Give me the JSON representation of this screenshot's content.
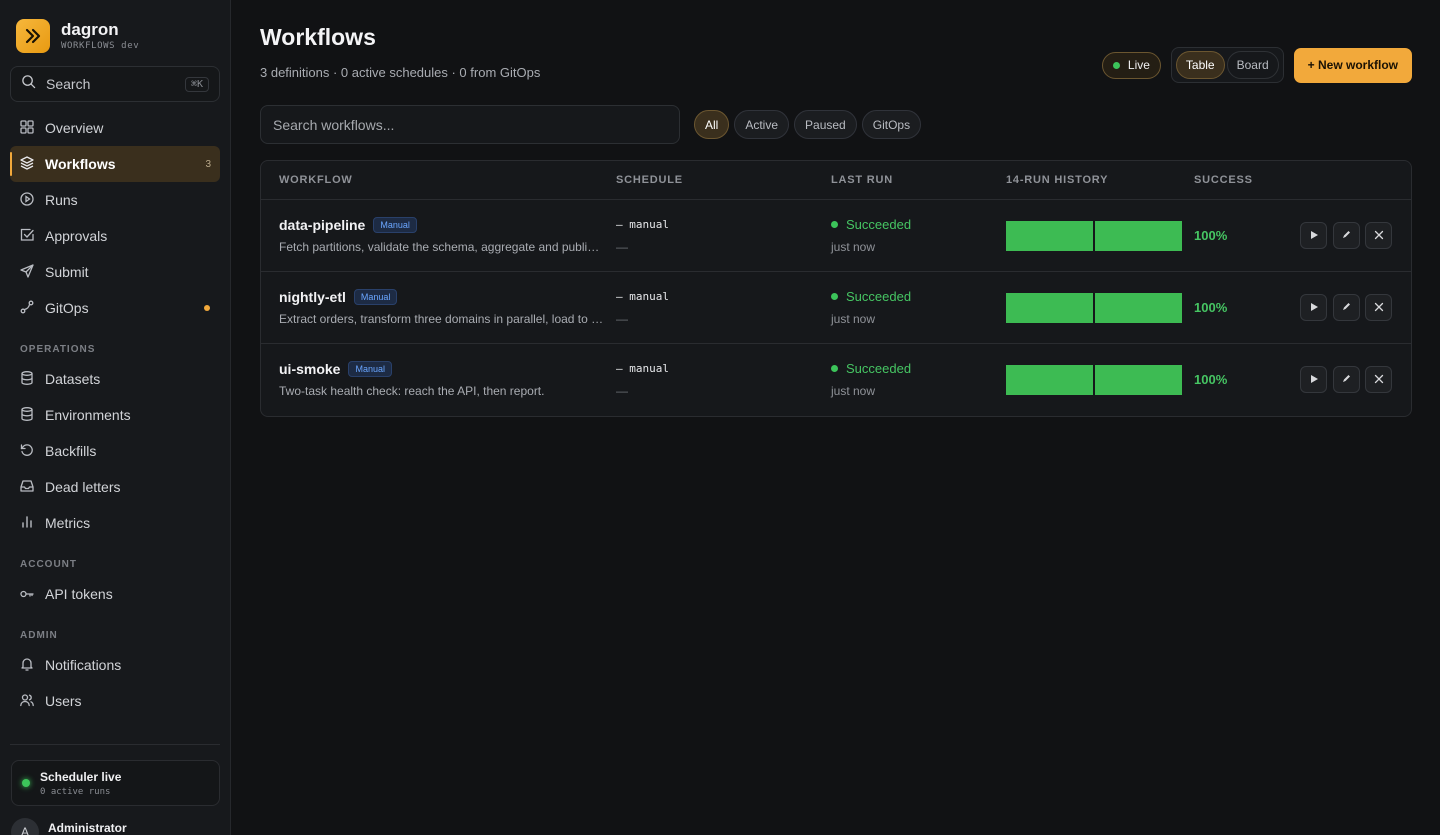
{
  "brand": {
    "name": "dagron",
    "subtitle": "WORKFLOWS",
    "env": "dev"
  },
  "search": {
    "label": "Search",
    "shortcut": "⌘K"
  },
  "nav": {
    "main": [
      {
        "label": "Overview",
        "icon": "grid-icon"
      },
      {
        "label": "Workflows",
        "icon": "layers-icon",
        "count": "3",
        "active": true
      },
      {
        "label": "Runs",
        "icon": "play-circle-icon"
      },
      {
        "label": "Approvals",
        "icon": "check-square-icon"
      },
      {
        "label": "Submit",
        "icon": "send-icon"
      },
      {
        "label": "GitOps",
        "icon": "git-branch-icon",
        "indicator": true
      }
    ],
    "operations_label": "OPERATIONS",
    "operations": [
      {
        "label": "Datasets",
        "icon": "database-icon"
      },
      {
        "label": "Environments",
        "icon": "database-icon"
      },
      {
        "label": "Backfills",
        "icon": "rotate-ccw-icon"
      },
      {
        "label": "Dead letters",
        "icon": "inbox-icon"
      },
      {
        "label": "Metrics",
        "icon": "bar-chart-icon"
      }
    ],
    "account_label": "ACCOUNT",
    "account": [
      {
        "label": "API tokens",
        "icon": "key-icon"
      }
    ],
    "admin_label": "ADMIN",
    "admin": [
      {
        "label": "Notifications",
        "icon": "bell-icon"
      },
      {
        "label": "Users",
        "icon": "users-icon"
      }
    ]
  },
  "scheduler": {
    "title": "Scheduler live",
    "subtitle": "0 active runs"
  },
  "user": {
    "initial": "A",
    "name": "Administrator"
  },
  "page": {
    "title": "Workflows",
    "subtitle": "3 definitions · 0 active schedules · 0 from GitOps"
  },
  "toolbar": {
    "live_label": "Live",
    "view_table": "Table",
    "view_board": "Board",
    "new_workflow": "+ New workflow"
  },
  "filter": {
    "placeholder": "Search workflows...",
    "chips": [
      "All",
      "Active",
      "Paused",
      "GitOps"
    ]
  },
  "table": {
    "headers": {
      "workflow": "WORKFLOW",
      "schedule": "SCHEDULE",
      "last_run": "LAST RUN",
      "history": "14-RUN HISTORY",
      "success": "SUCCESS"
    },
    "rows": [
      {
        "name": "data-pipeline",
        "badge": "Manual",
        "description": "Fetch partitions, validate the schema, aggregate and publish the results.",
        "schedule": "— manual",
        "schedule_sub": "—",
        "status": "Succeeded",
        "when": "just now",
        "success": "100%",
        "history_colors": [
          "#3dbb53",
          "#3dbb53"
        ]
      },
      {
        "name": "nightly-etl",
        "badge": "Manual",
        "description": "Extract orders, transform three domains in parallel, load to the warehouse.",
        "schedule": "— manual",
        "schedule_sub": "—",
        "status": "Succeeded",
        "when": "just now",
        "success": "100%",
        "history_colors": [
          "#3dbb53",
          "#3dbb53"
        ]
      },
      {
        "name": "ui-smoke",
        "badge": "Manual",
        "description": "Two-task health check: reach the API, then report.",
        "schedule": "— manual",
        "schedule_sub": "—",
        "status": "Succeeded",
        "when": "just now",
        "success": "100%",
        "history_colors": [
          "#3dbb53",
          "#3dbb53"
        ]
      }
    ],
    "row_actions": [
      "play-icon",
      "edit-icon",
      "close-icon"
    ]
  }
}
